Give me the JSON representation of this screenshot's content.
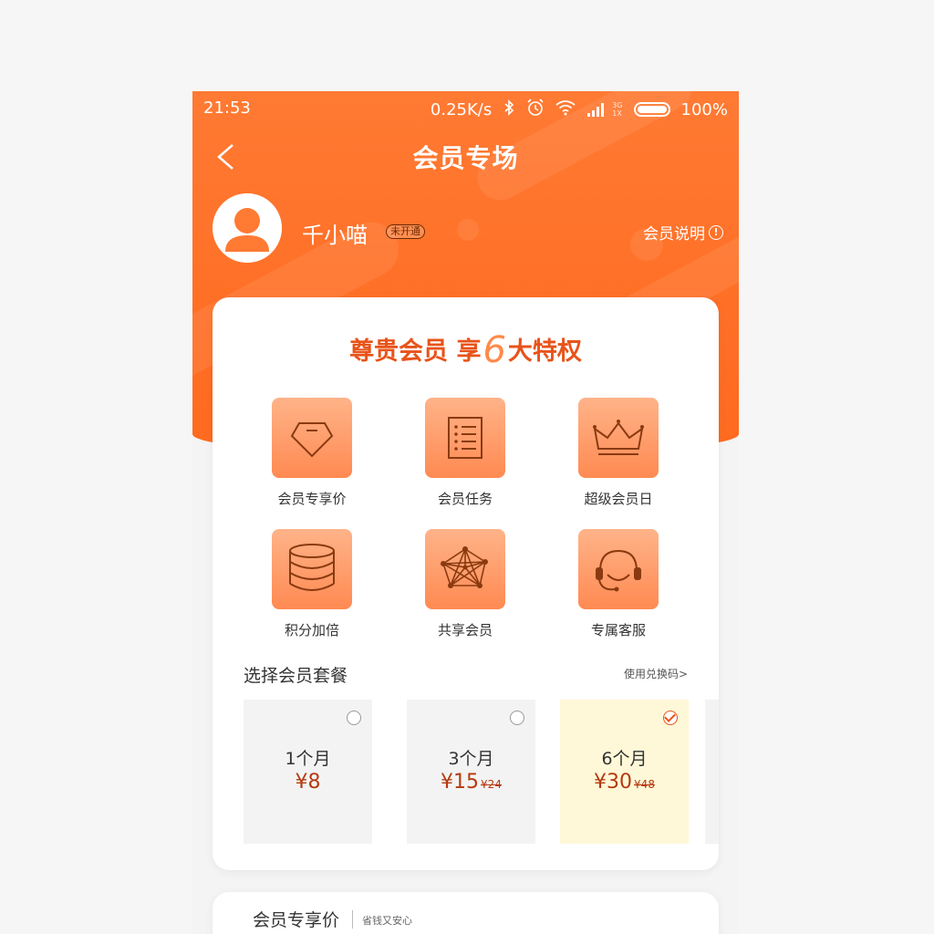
{
  "status_bar": {
    "time": "21:53",
    "speed": "0.25K/s",
    "network": "3G",
    "network_sub": "1X",
    "battery": "100%"
  },
  "nav": {
    "title": "会员专场"
  },
  "user": {
    "name": "千小喵",
    "badge": "未开通",
    "member_info_label": "会员说明",
    "info_icon": "!"
  },
  "privileges": {
    "title_prefix": "尊贵会员 享",
    "title_number": "6",
    "title_suffix": "大特权",
    "items": [
      {
        "label": "会员专享价",
        "icon": "diamond-icon"
      },
      {
        "label": "会员任务",
        "icon": "checklist-icon"
      },
      {
        "label": "超级会员日",
        "icon": "crown-icon"
      },
      {
        "label": "积分加倍",
        "icon": "coin-stack-icon"
      },
      {
        "label": "共享会员",
        "icon": "network-icon"
      },
      {
        "label": "专属客服",
        "icon": "headset-icon"
      }
    ]
  },
  "plans": {
    "section_title": "选择会员套餐",
    "redeem_link": "使用兑换码>",
    "items": [
      {
        "months": "1个月",
        "price": "¥8",
        "original": "",
        "selected": false
      },
      {
        "months": "3个月",
        "price": "¥15",
        "original": "¥24",
        "selected": false
      },
      {
        "months": "6个月",
        "price": "¥30",
        "original": "¥48",
        "selected": true
      }
    ]
  },
  "bottom_card": {
    "title": "会员专享价",
    "subtitle": "省钱又安心"
  },
  "colors": {
    "header": "#ff6f26",
    "accent": "#e8531a",
    "icon_bg": "#ff8a52",
    "selected_plan_bg": "#fff8d8"
  }
}
